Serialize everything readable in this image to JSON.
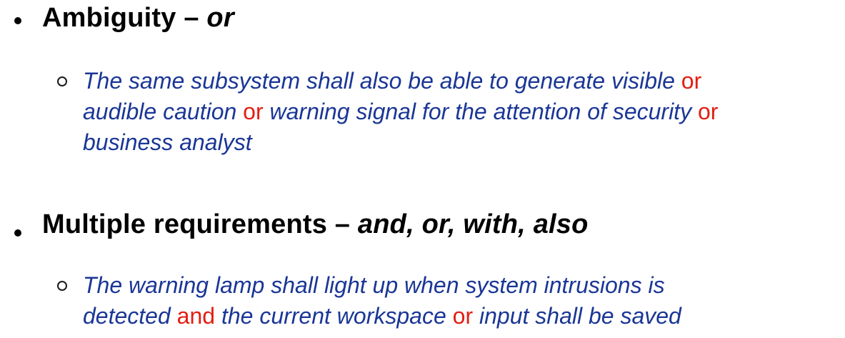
{
  "colors": {
    "heading": "#000000",
    "example_text": "#1a3696",
    "keyword": "#e31e12"
  },
  "sections": [
    {
      "heading": "Ambiguity – ",
      "heading_keywords": "or",
      "example_lines": [
        [
          "The same subsystem shall also be able to generate visible ",
          "or",
          ""
        ],
        [
          "audible caution ",
          "or",
          " warning signal for the attention of security ",
          "or"
        ],
        [
          "business analyst"
        ]
      ]
    },
    {
      "heading": "Multiple requirements – ",
      "heading_keywords": "and, or, with, also",
      "example_lines": [
        [
          "The warning lamp shall light up when system intrusions is"
        ],
        [
          "detected ",
          "and",
          " the current workspace ",
          "or",
          " input shall be saved"
        ]
      ]
    }
  ]
}
